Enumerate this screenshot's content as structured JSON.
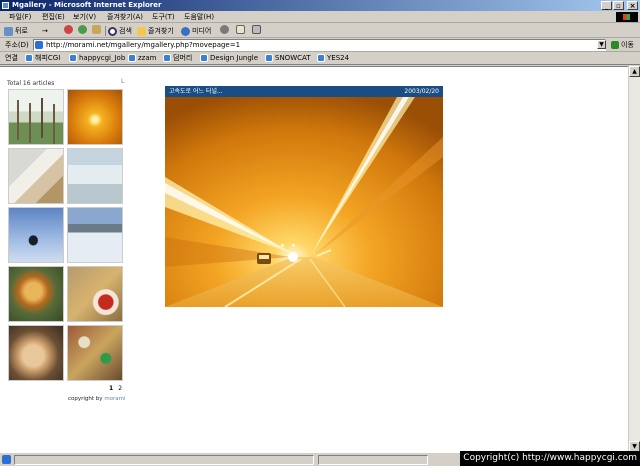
{
  "window": {
    "title": "Mgallery - Microsoft Internet Explorer",
    "buttons": [
      "_",
      "▫",
      "×"
    ]
  },
  "menu": [
    "파일(F)",
    "편집(E)",
    "보기(V)",
    "즐겨찾기(A)",
    "도구(T)",
    "도움말(H)"
  ],
  "toolbar": {
    "back": "뒤로",
    "forward": "→",
    "search": "검색",
    "favorites": "즐겨찾기",
    "media": "미디어"
  },
  "address": {
    "label": "주소(D)",
    "url": "http://morami.net/mgallery/mgallery.php?movepage=1",
    "go": "이동"
  },
  "links": {
    "label": "연결",
    "items": [
      "해피CGI",
      "happycgi_Job",
      "zzam",
      "덤머리",
      "Design Jungle",
      "SNOWCAT",
      "YES24"
    ]
  },
  "gallery": {
    "total": "Total 16 articles",
    "corner_mark": "L",
    "pages": [
      "1",
      "2"
    ],
    "copyright_prefix": "copyright by",
    "copyright_author": "morami"
  },
  "photo": {
    "title": "고속도로 어느 터널...",
    "date": "2003/02/20"
  },
  "watermark": "Copyright(c) http://www.happycgi.com"
}
